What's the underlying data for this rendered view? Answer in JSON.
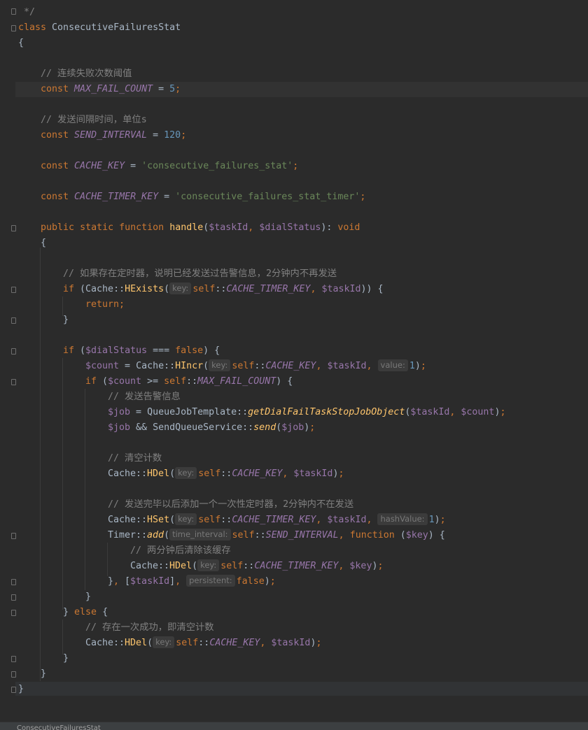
{
  "editor": {
    "highlighted_line": "line_4",
    "lines": {
      "line_0": {
        "close": "*/"
      },
      "line_1": {
        "kw": "class",
        "name": "ConsecutiveFailuresStat"
      },
      "line_2": {
        "brace": "{"
      },
      "line_4": {
        "comment": "// 连续失败次数阈值"
      },
      "line_5": {
        "kw": "const",
        "name": "MAX_FAIL_COUNT",
        "eq": " = ",
        "val": "5",
        "end": ";"
      },
      "line_7": {
        "comment": "// 发送间隔时间，单位s"
      },
      "line_8": {
        "kw": "const",
        "name": "SEND_INTERVAL",
        "eq": " = ",
        "val": "120",
        "end": ";"
      },
      "line_10": {
        "kw": "const",
        "name": "CACHE_KEY",
        "eq": " = ",
        "val": "'consecutive_failures_stat'",
        "end": ";"
      },
      "line_12": {
        "kw": "const",
        "name": "CACHE_TIMER_KEY",
        "eq": " = ",
        "val": "'consecutive_failures_stat_timer'",
        "end": ";"
      },
      "line_14": {
        "kw1": "public",
        "kw2": "static",
        "kw3": "function",
        "fn": "handle",
        "p1": "$taskId",
        "p2": "$dialStatus",
        "ret": "void"
      },
      "line_15": {
        "brace": "{"
      },
      "line_17": {
        "comment": "// 如果存在定时器，说明已经发送过告警信息，2分钟内不再发送"
      },
      "line_18": {
        "kw": "if",
        "cls": "Cache",
        "fn": "HExists",
        "hint": "key:",
        "self": "self",
        "const": "CACHE_TIMER_KEY",
        "var": "$taskId"
      },
      "line_19": {
        "kw": "return",
        "end": ";"
      },
      "line_20": {
        "brace": "}"
      },
      "line_22": {
        "kw": "if",
        "var": "$dialStatus",
        "op": " === ",
        "kw2": "false",
        "brace": " {"
      },
      "line_23": {
        "var": "$count",
        "cls": "Cache",
        "fn": "HIncr",
        "hint1": "key:",
        "self": "self",
        "const": "CACHE_KEY",
        "var2": "$taskId",
        "hint2": "value:",
        "num": "1"
      },
      "line_24": {
        "kw": "if",
        "var": "$count",
        "op": " >= ",
        "self": "self",
        "const": "MAX_FAIL_COUNT"
      },
      "line_25": {
        "comment": "// 发送告警信息"
      },
      "line_26": {
        "var": "$job",
        "cls": "QueueJobTemplate",
        "fn": "getDialFailTaskStopJobObject",
        "a1": "$taskId",
        "a2": "$count"
      },
      "line_27": {
        "var": "$job",
        "op": " && ",
        "cls": "SendQueueService",
        "fn": "send",
        "a1": "$job"
      },
      "line_29": {
        "comment": "// 清空计数"
      },
      "line_30": {
        "cls": "Cache",
        "fn": "HDel",
        "hint": "key:",
        "self": "self",
        "const": "CACHE_KEY",
        "var": "$taskId"
      },
      "line_32": {
        "comment": "// 发送完毕以后添加一个一次性定时器，2分钟内不在发送"
      },
      "line_33": {
        "cls": "Cache",
        "fn": "HSet",
        "hint1": "key:",
        "self": "self",
        "const": "CACHE_TIMER_KEY",
        "var": "$taskId",
        "hint2": "hashValue:",
        "num": "1"
      },
      "line_34": {
        "cls": "Timer",
        "fn": "add",
        "hint": "time_interval:",
        "self": "self",
        "const": "SEND_INTERVAL",
        "kw": "function",
        "var": "$key"
      },
      "line_35": {
        "comment": "// 两分钟后清除该缓存"
      },
      "line_36": {
        "cls": "Cache",
        "fn": "HDel",
        "hint": "key:",
        "self": "self",
        "const": "CACHE_TIMER_KEY",
        "var": "$key"
      },
      "line_37": {
        "var": "$taskId",
        "hint": "persistent:",
        "kw": "false"
      },
      "line_38": {
        "brace": "}"
      },
      "line_39": {
        "brace": "}",
        "kw": "else",
        "brace2": " {"
      },
      "line_40": {
        "comment": "// 存在一次成功，即清空计数"
      },
      "line_41": {
        "cls": "Cache",
        "fn": "HDel",
        "hint": "key:",
        "self": "self",
        "const": "CACHE_KEY",
        "var": "$taskId"
      },
      "line_42": {
        "brace": "}"
      },
      "line_43": {
        "brace": "}"
      },
      "line_44": {
        "brace": "}"
      }
    }
  },
  "status_bar": {
    "breadcrumb": "ConsecutiveFailuresStat"
  },
  "colors": {
    "background": "#2b2b2b",
    "current_line": "#323232",
    "keyword": "#cc7832",
    "constant": "#9876aa",
    "string": "#6a8759",
    "number": "#6897bb",
    "comment": "#808080",
    "function": "#ffc66d"
  }
}
